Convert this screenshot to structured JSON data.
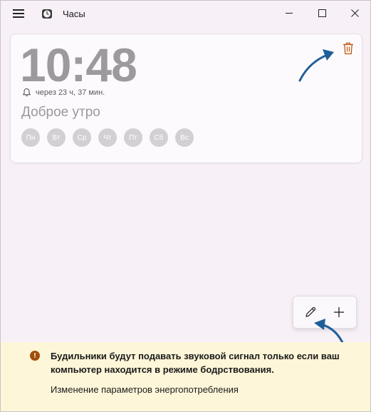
{
  "app": {
    "title": "Часы"
  },
  "alarm": {
    "time": "10:48",
    "remaining": "через 23 ч, 37 мин.",
    "name": "Доброе утро",
    "days": [
      "Пн",
      "Вт",
      "Ср",
      "Чт",
      "Пт",
      "Сб",
      "Вс"
    ]
  },
  "notice": {
    "message": "Будильники будут подавать звуковой сигнал только если ваш компьютер находится в режиме бодрствования.",
    "link": "Изменение параметров энергопотребления"
  },
  "icons": {
    "menu": "hamburger-icon",
    "app": "clock-icon",
    "minimize": "minimize-icon",
    "maximize": "maximize-icon",
    "close": "close-icon",
    "delete": "trash-icon",
    "edit": "pencil-icon",
    "add": "plus-icon",
    "bell": "bell-icon",
    "info": "warning-icon"
  },
  "colors": {
    "background": "#f7f0f7",
    "card": "#fdfafd",
    "accent_delete": "#c0550f",
    "annotation_arrow": "#1f5f99",
    "day_inactive": "#d3d0d3",
    "banner": "#fdf6d8",
    "banner_icon": "#a04f0a"
  }
}
